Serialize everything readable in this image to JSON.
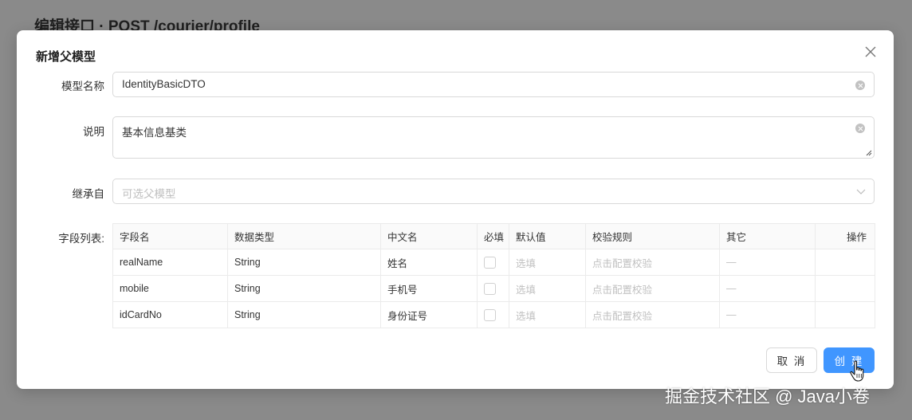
{
  "page": {
    "title": "编辑接口 · POST /courier/profile"
  },
  "modal": {
    "title": "新增父模型",
    "form": {
      "model_name": {
        "label": "模型名称",
        "value": "IdentityBasicDTO"
      },
      "description": {
        "label": "说明",
        "value": "基本信息基类"
      },
      "inherit": {
        "label": "继承自",
        "placeholder": "可选父模型"
      },
      "fields": {
        "label": "字段列表:"
      }
    },
    "table": {
      "headers": [
        "字段名",
        "数据类型",
        "中文名",
        "必填",
        "默认值",
        "校验规则",
        "其它",
        "操作"
      ],
      "rows": [
        {
          "field": "realName",
          "type": "String",
          "cn_name": "姓名",
          "default": "选填",
          "rule": "点击配置校验",
          "other": "—"
        },
        {
          "field": "mobile",
          "type": "String",
          "cn_name": "手机号",
          "default": "选填",
          "rule": "点击配置校验",
          "other": "—"
        },
        {
          "field": "idCardNo",
          "type": "String",
          "cn_name": "身份证号",
          "default": "选填",
          "rule": "点击配置校验",
          "other": "—"
        }
      ]
    },
    "buttons": {
      "cancel": "取 消",
      "create": "创 建"
    }
  },
  "watermark": "掘金技术社区 @ Java小卷",
  "colors": {
    "primary": "#4096ff",
    "overlay": "#8a8a8a"
  }
}
